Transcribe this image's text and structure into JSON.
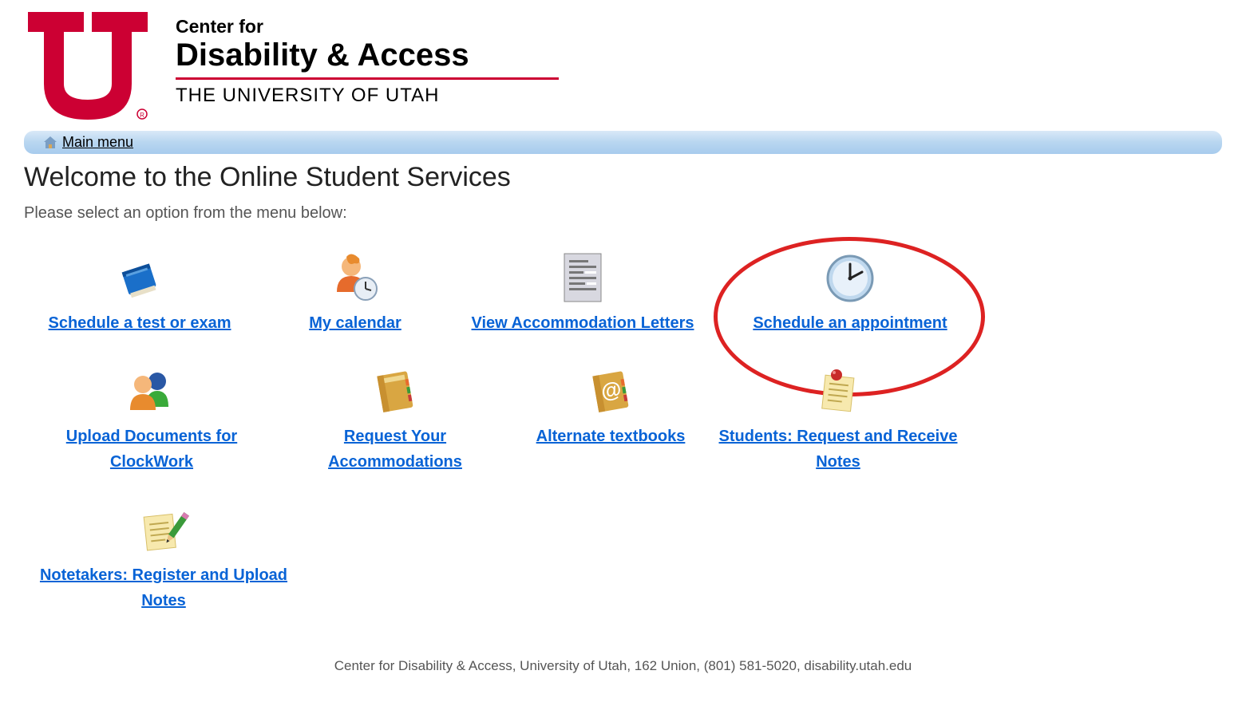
{
  "header": {
    "center_for": "Center for",
    "disability_access": "Disability & Access",
    "university": "THE UNIVERSITY OF UTAH"
  },
  "menu": {
    "main_label": "Main menu"
  },
  "page": {
    "title": "Welcome to the Online Student Services",
    "instruction": "Please select an option from the menu below:"
  },
  "items": [
    {
      "label": "Schedule a test or exam",
      "icon": "book"
    },
    {
      "label": "My calendar",
      "icon": "person-clock"
    },
    {
      "label": "View Accommodation Letters",
      "icon": "document"
    },
    {
      "label": "Schedule an appointment",
      "icon": "clock",
      "highlighted": true
    },
    {
      "label": "Upload Documents for ClockWork",
      "icon": "people"
    },
    {
      "label": "Request Your Accommodations",
      "icon": "notebook-yellow"
    },
    {
      "label": "Alternate textbooks",
      "icon": "notebook-at"
    },
    {
      "label": "Students: Request and Receive Notes",
      "icon": "note-pin"
    },
    {
      "label": "Notetakers: Register and Upload Notes",
      "icon": "note-pencil"
    }
  ],
  "footer": {
    "text": "Center for Disability & Access, University of Utah, 162 Union, (801) 581-5020, disability.utah.edu"
  }
}
